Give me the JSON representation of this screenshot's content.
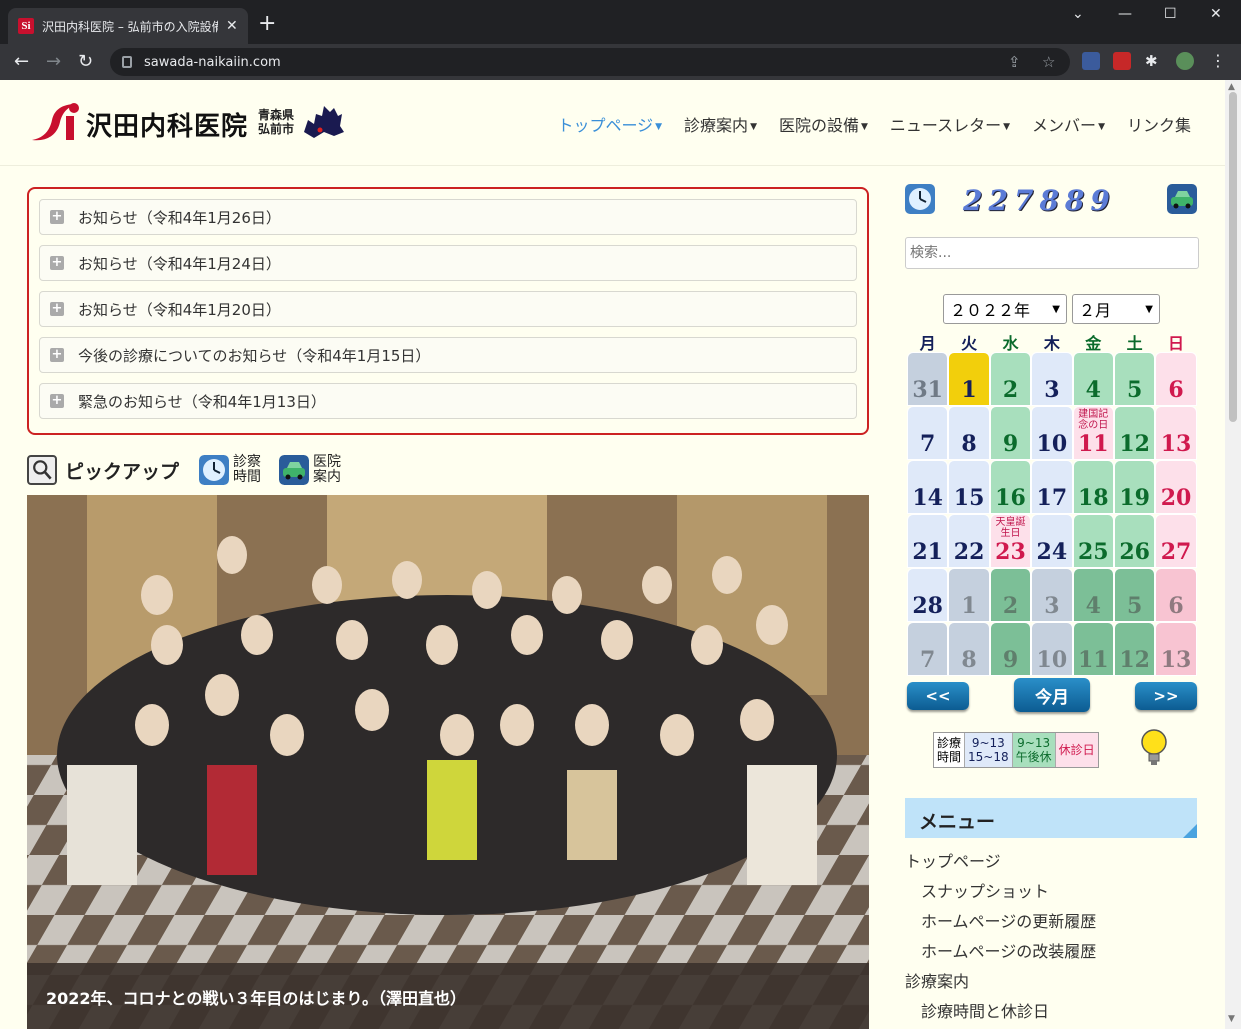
{
  "browser": {
    "tab_title": "沢田内科医院 – 弘前市の入院設備",
    "tab_favicon": "Si",
    "url": "sawada-naikaiin.com",
    "new_tab": "+",
    "minimize": "—",
    "maximize": "☐",
    "close": "✕",
    "chevron": "⌄"
  },
  "site": {
    "logo_text": "沢田内科医院",
    "logo_pref_line1": "青森県",
    "logo_pref_line2": "弘前市",
    "nav": [
      {
        "label": "トップページ",
        "active": true,
        "caret": true
      },
      {
        "label": "診療案内",
        "caret": true
      },
      {
        "label": "医院の設備",
        "caret": true
      },
      {
        "label": "ニュースレター",
        "caret": true
      },
      {
        "label": "メンバー",
        "caret": true
      },
      {
        "label": "リンク集",
        "caret": false
      }
    ],
    "notices": [
      "お知らせ（令和4年1月26日）",
      "お知らせ（令和4年1月24日）",
      "お知らせ（令和4年1月20日）",
      "今後の診療についてのお知らせ（令和4年1月15日）",
      "緊急のお知らせ（令和4年1月13日）"
    ],
    "pickup_title": "ピックアップ",
    "pickup_hours_l1": "診察",
    "pickup_hours_l2": "時間",
    "pickup_guide_l1": "医院",
    "pickup_guide_l2": "案内",
    "photo_caption": "2022年、コロナとの戦い３年目のはじまり。（澤田直也）"
  },
  "sidebar": {
    "counter": "227889",
    "search_placeholder": "検索...",
    "cal_year": "２０２２年",
    "cal_month": "２月",
    "weekdays": [
      "月",
      "火",
      "水",
      "木",
      "金",
      "土",
      "日"
    ],
    "weekday_colors": [
      "#14205a",
      "#14205a",
      "#0b6b2c",
      "#14205a",
      "#0b6b2c",
      "#0b6b2c",
      "#d0194e"
    ],
    "days": [
      {
        "n": "31",
        "c": "bg-prev"
      },
      {
        "n": "1",
        "c": "bg-today"
      },
      {
        "n": "2",
        "c": "bg-green"
      },
      {
        "n": "3",
        "c": "bg-blue"
      },
      {
        "n": "4",
        "c": "bg-green"
      },
      {
        "n": "5",
        "c": "bg-green"
      },
      {
        "n": "6",
        "c": "bg-pink"
      },
      {
        "n": "7",
        "c": "bg-blue"
      },
      {
        "n": "8",
        "c": "bg-blue"
      },
      {
        "n": "9",
        "c": "bg-green"
      },
      {
        "n": "10",
        "c": "bg-blue"
      },
      {
        "n": "11",
        "c": "bg-pink",
        "hol": "建国記念の日"
      },
      {
        "n": "12",
        "c": "bg-green"
      },
      {
        "n": "13",
        "c": "bg-pink"
      },
      {
        "n": "14",
        "c": "bg-blue"
      },
      {
        "n": "15",
        "c": "bg-blue"
      },
      {
        "n": "16",
        "c": "bg-green"
      },
      {
        "n": "17",
        "c": "bg-blue"
      },
      {
        "n": "18",
        "c": "bg-green"
      },
      {
        "n": "19",
        "c": "bg-green"
      },
      {
        "n": "20",
        "c": "bg-pink"
      },
      {
        "n": "21",
        "c": "bg-blue"
      },
      {
        "n": "22",
        "c": "bg-blue"
      },
      {
        "n": "23",
        "c": "bg-pink",
        "hol": "天皇誕生日"
      },
      {
        "n": "24",
        "c": "bg-blue"
      },
      {
        "n": "25",
        "c": "bg-green"
      },
      {
        "n": "26",
        "c": "bg-green"
      },
      {
        "n": "27",
        "c": "bg-pink"
      },
      {
        "n": "28",
        "c": "bg-blue"
      },
      {
        "n": "1",
        "c": "bg-next-b"
      },
      {
        "n": "2",
        "c": "bg-next-g"
      },
      {
        "n": "3",
        "c": "bg-next-b"
      },
      {
        "n": "4",
        "c": "bg-next-g"
      },
      {
        "n": "5",
        "c": "bg-next-g"
      },
      {
        "n": "6",
        "c": "bg-next-p"
      },
      {
        "n": "7",
        "c": "bg-next-b"
      },
      {
        "n": "8",
        "c": "bg-next-b"
      },
      {
        "n": "9",
        "c": "bg-next-g"
      },
      {
        "n": "10",
        "c": "bg-next-b"
      },
      {
        "n": "11",
        "c": "bg-next-g"
      },
      {
        "n": "12",
        "c": "bg-next-g"
      },
      {
        "n": "13",
        "c": "bg-next-p"
      }
    ],
    "btn_prev": "<<",
    "btn_today": "今月",
    "btn_next": ">>",
    "legend": {
      "label_l1": "診療",
      "label_l2": "時間",
      "normal_l1": "9~13",
      "normal_l2": "15~18",
      "half_l1": "9~13",
      "half_l2": "午後休",
      "closed": "休診日"
    },
    "menu_title": "メニュー",
    "menu_items": [
      {
        "label": "トップページ",
        "sub": false
      },
      {
        "label": "スナップショット",
        "sub": true
      },
      {
        "label": "ホームページの更新履歴",
        "sub": true
      },
      {
        "label": "ホームページの改装履歴",
        "sub": true
      },
      {
        "label": "診療案内",
        "sub": false
      },
      {
        "label": "診療時間と休診日",
        "sub": true
      }
    ]
  }
}
